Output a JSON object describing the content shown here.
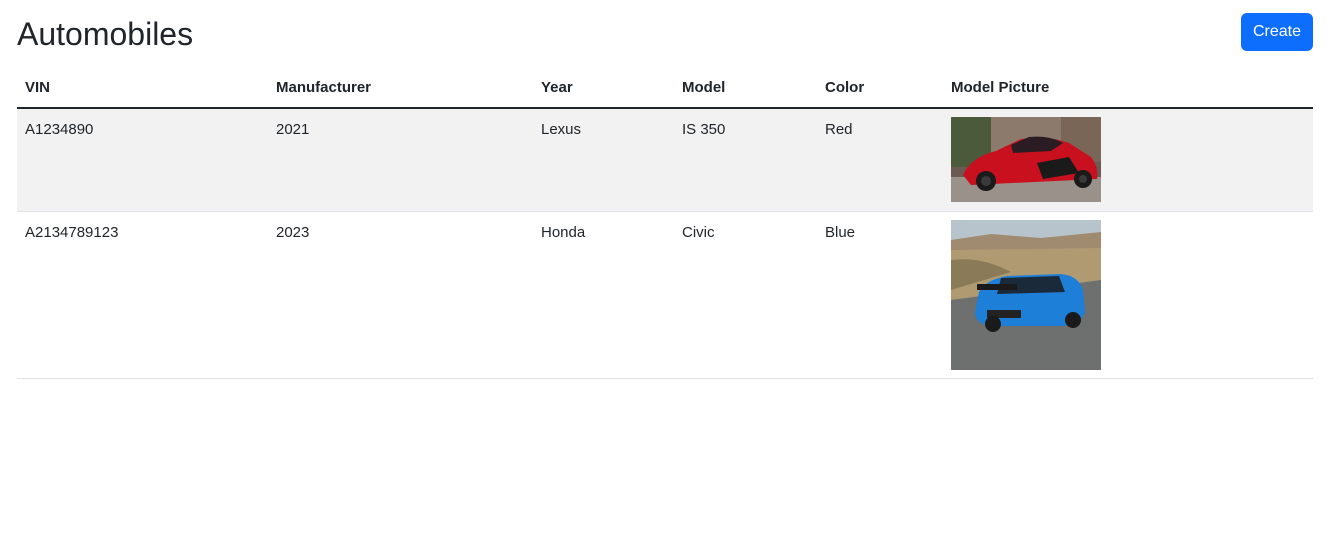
{
  "header": {
    "title": "Automobiles",
    "create_label": "Create",
    "accent_color": "#0d6efd"
  },
  "table": {
    "columns": [
      "VIN",
      "Manufacturer",
      "Year",
      "Model",
      "Color",
      "Model Picture"
    ],
    "rows": [
      {
        "vin": "A1234890",
        "manufacturer": "2021",
        "year": "Lexus",
        "model": "IS 350",
        "color": "Red",
        "picture": "red-lexus-sedan-photo"
      },
      {
        "vin": "A2134789123",
        "manufacturer": "2023",
        "year": "Honda",
        "model": "Civic",
        "color": "Blue",
        "picture": "blue-honda-civic-photo"
      }
    ]
  }
}
